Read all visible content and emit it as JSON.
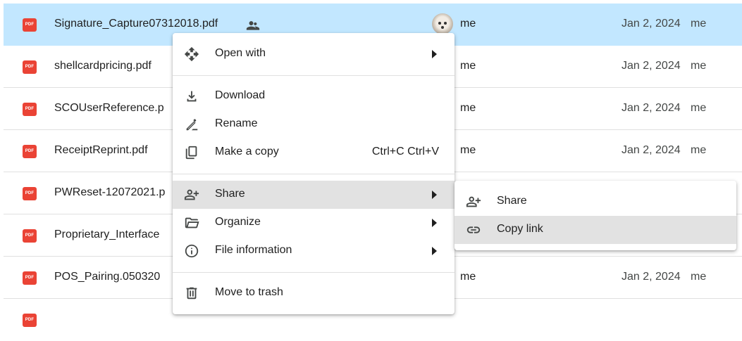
{
  "files": [
    {
      "name": "Signature_Capture07312018.pdf",
      "owner": "me",
      "date": "Jan 2, 2024",
      "modified_by": "me",
      "shared": true,
      "selected": true,
      "icon": "pdf-icon"
    },
    {
      "name": "shellcardpricing.pdf",
      "owner": "me",
      "date": "Jan 2, 2024",
      "modified_by": "me",
      "shared": false,
      "selected": false,
      "icon": "pdf-icon"
    },
    {
      "name": "SCOUserReference.p",
      "owner": "me",
      "date": "Jan 2, 2024",
      "modified_by": "me",
      "shared": false,
      "selected": false,
      "icon": "pdf-icon"
    },
    {
      "name": "ReceiptReprint.pdf",
      "owner": "me",
      "date": "Jan 2, 2024",
      "modified_by": "me",
      "shared": false,
      "selected": false,
      "icon": "pdf-icon"
    },
    {
      "name": "PWReset-12072021.p",
      "owner": "",
      "date": "",
      "modified_by": "",
      "shared": false,
      "selected": false,
      "icon": "pdf-icon"
    },
    {
      "name": "Proprietary_Interface",
      "owner": "",
      "date": "",
      "modified_by": "",
      "shared": false,
      "selected": false,
      "icon": "pdf-icon"
    },
    {
      "name": "POS_Pairing.050320",
      "owner": "me",
      "date": "Jan 2, 2024",
      "modified_by": "me",
      "shared": false,
      "selected": false,
      "icon": "pdf-icon"
    }
  ],
  "pdf_badge": "PDF",
  "context_menu": {
    "open_with": "Open with",
    "download": "Download",
    "rename": "Rename",
    "make_copy": "Make a copy",
    "make_copy_shortcut": "Ctrl+C Ctrl+V",
    "share": "Share",
    "organize": "Organize",
    "file_information": "File information",
    "move_to_trash": "Move to trash"
  },
  "share_submenu": {
    "share": "Share",
    "copy_link": "Copy link"
  },
  "colors": {
    "selected_row": "#c2e7ff",
    "pdf_red": "#ea4335",
    "menu_highlight": "#e2e2e2"
  }
}
